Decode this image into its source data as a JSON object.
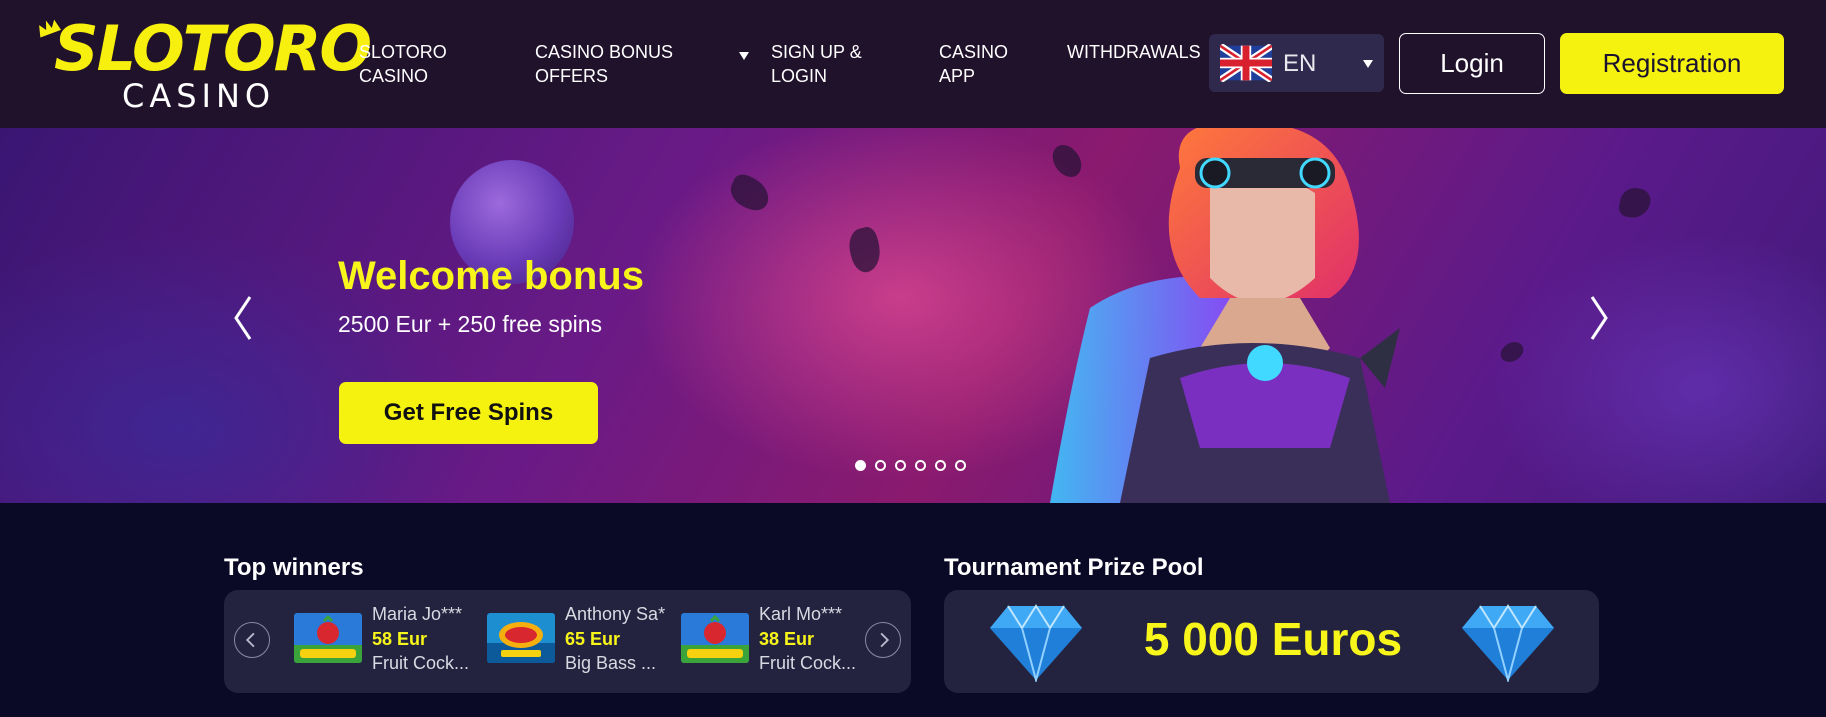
{
  "brand": {
    "name_top": "SLOTORO",
    "name_bottom": "CASINO"
  },
  "nav": [
    {
      "line1": "SLOTORO",
      "line2": "CASINO"
    },
    {
      "line1": "CASINO BONUS",
      "line2": "OFFERS"
    },
    {
      "line1": "SIGN UP &",
      "line2": "LOGIN"
    },
    {
      "line1": "CASINO",
      "line2": "APP"
    },
    {
      "line1": "WITHDRAWALS",
      "line2": ""
    }
  ],
  "language": {
    "code": "EN",
    "flag_icon": "uk-flag-icon"
  },
  "auth": {
    "login_label": "Login",
    "registration_label": "Registration"
  },
  "hero": {
    "title": "Welcome bonus",
    "subtitle": "2500 Eur + 250 free spins",
    "cta_label": "Get Free Spins",
    "slide_count": 6,
    "active_slide": 1
  },
  "top_winners": {
    "title": "Top winners",
    "items": [
      {
        "name": "Maria Jo***",
        "amount": "58 Eur",
        "game": "Fruit Cock...",
        "thumb": "fruit-cocktail"
      },
      {
        "name": "Anthony Sa***",
        "amount": "65 Eur",
        "game": "Big Bass ...",
        "thumb": "big-bass-bonanza"
      },
      {
        "name": "Karl Mo***",
        "amount": "38 Eur",
        "game": "Fruit Cock...",
        "thumb": "fruit-cocktail"
      }
    ]
  },
  "tournament": {
    "title": "Tournament Prize Pool",
    "amount": "5 000 Euros"
  },
  "colors": {
    "accent": "#f5f20f",
    "header_bg": "#21122b",
    "page_bg": "#0b0a26",
    "card_bg": "#24233f"
  }
}
